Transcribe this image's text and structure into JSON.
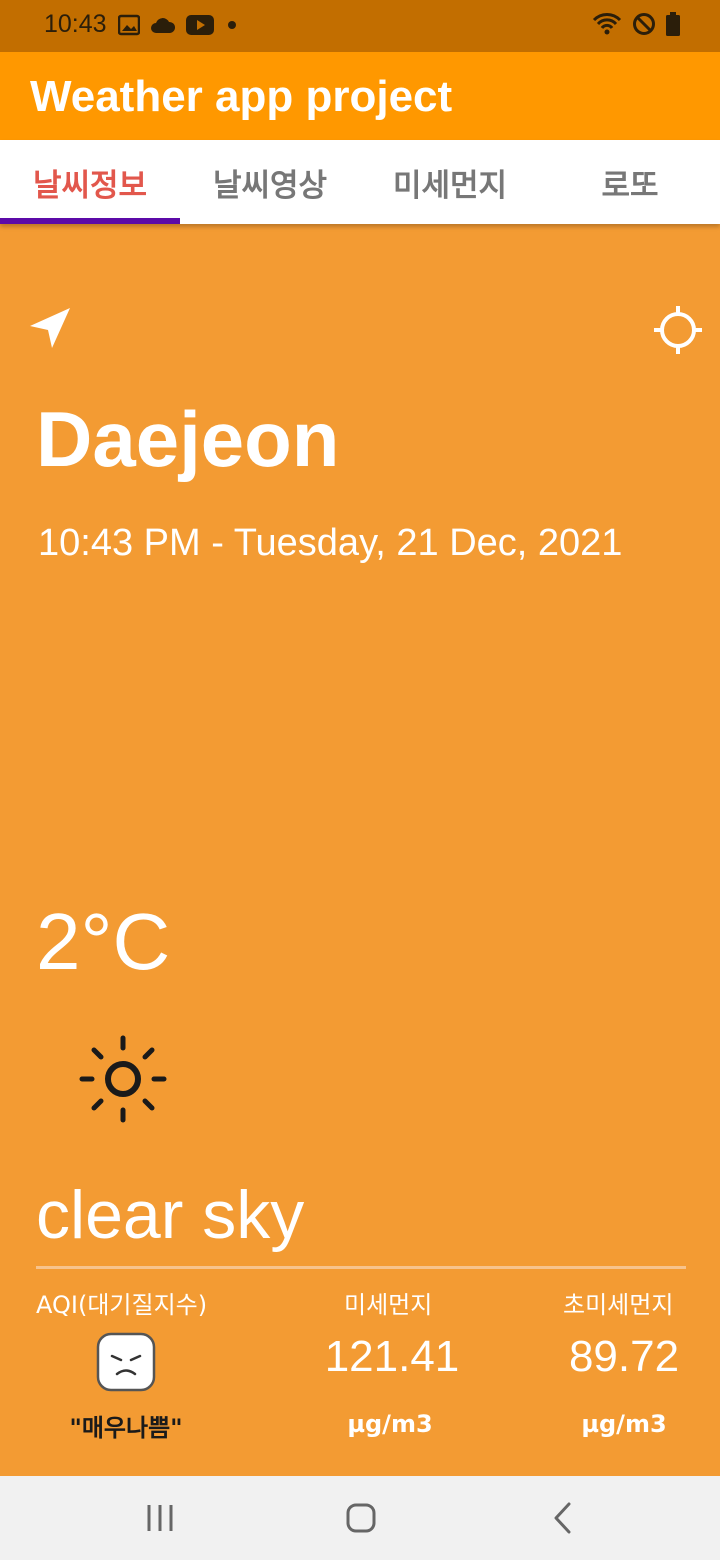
{
  "status_bar": {
    "time": "10:43",
    "icons": [
      "image-icon",
      "cloud-icon",
      "youtube-icon",
      "dot-icon",
      "wifi-icon",
      "do-not-disturb-icon",
      "battery-icon"
    ]
  },
  "app_bar": {
    "title": "Weather app project"
  },
  "tabs": [
    {
      "label": "날씨정보",
      "active": true
    },
    {
      "label": "날씨영상",
      "active": false
    },
    {
      "label": "미세먼지",
      "active": false
    },
    {
      "label": "로또",
      "active": false
    }
  ],
  "weather": {
    "city": "Daejeon",
    "datetime": "10:43 PM - Tuesday, 21 Dec, 2021",
    "temperature": "2°C",
    "description": "clear sky",
    "icon": "sun-icon"
  },
  "air_quality": {
    "aqi_label": "AQI(대기질지수)",
    "aqi_status": "\"매우나쁨\"",
    "pm10_label": "미세먼지",
    "pm10_value": "121.41",
    "pm10_unit": "µg/m3",
    "pm25_label": "초미세먼지",
    "pm25_value": "89.72",
    "pm25_unit": "µg/m3"
  },
  "colors": {
    "status_bar": "#c26e00",
    "app_bar": "#ff9800",
    "background": "#f39b33",
    "active_tab": "#e2574c",
    "tab_indicator": "#5c0aa8"
  },
  "system_nav": {
    "buttons": [
      "recent-apps-icon",
      "home-icon",
      "back-icon"
    ]
  }
}
